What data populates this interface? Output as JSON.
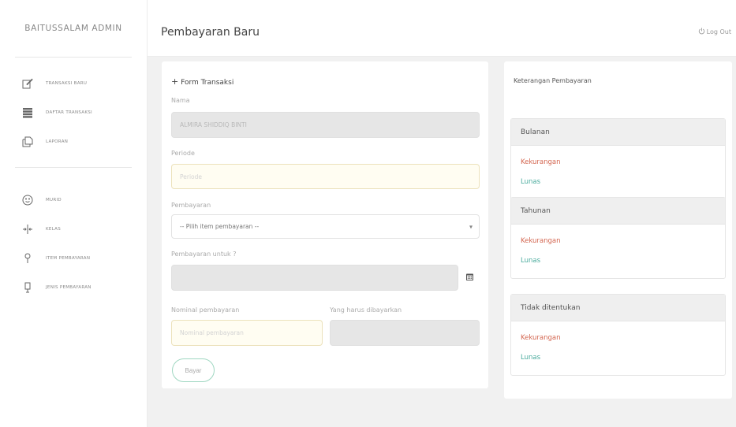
{
  "brand": "BAITUSSALAM ADMIN",
  "nav": {
    "group1": [
      {
        "label": "TRANSAKSI BARU",
        "icon": "edit-icon"
      },
      {
        "label": "DAFTAR TRANSAKSI",
        "icon": "list-icon"
      },
      {
        "label": "LAPORAN",
        "icon": "copy-icon"
      }
    ],
    "group2": [
      {
        "label": "MURID",
        "icon": "smiley-icon"
      },
      {
        "label": "KELAS",
        "icon": "split-arrows-icon"
      },
      {
        "label": "ITEM PEMBAYARAN",
        "icon": "pin-icon"
      },
      {
        "label": "JENIS PEMBAYARAN",
        "icon": "bookmark-icon"
      }
    ]
  },
  "header": {
    "title": "Pembayaran Baru",
    "logout": "Log Out",
    "logout_icon": "power-icon"
  },
  "form": {
    "title": "Form Transaksi",
    "nama_label": "Nama",
    "nama_value": "ALMIRA SHIDDIQ BINTI",
    "periode_label": "Periode",
    "periode_placeholder": "Periode",
    "pembayaran_label": "Pembayaran",
    "pembayaran_value": "-- Pilih item pembayaran --",
    "untuk_label": "Pembayaran untuk ?",
    "nominal_label": "Nominal pembayaran",
    "nominal_placeholder": "Nominal pembayaran",
    "harus_label": "Yang harus dibayarkan",
    "save_label": "Bayar"
  },
  "info": {
    "title": "Keterangan Pembayaran",
    "panels": [
      {
        "title": "Bulanan",
        "kurang": "Kekurangan",
        "lunas": "Lunas"
      },
      {
        "title": "Tahunan",
        "kurang": "Kekurangan",
        "lunas": "Lunas"
      },
      {
        "title": "Tidak ditentukan",
        "kurang": "Kekurangan",
        "lunas": "Lunas"
      }
    ]
  },
  "colors": {
    "accent": "#9fd7c1",
    "kurang": "#d3654f",
    "lunas": "#4aab9d"
  }
}
